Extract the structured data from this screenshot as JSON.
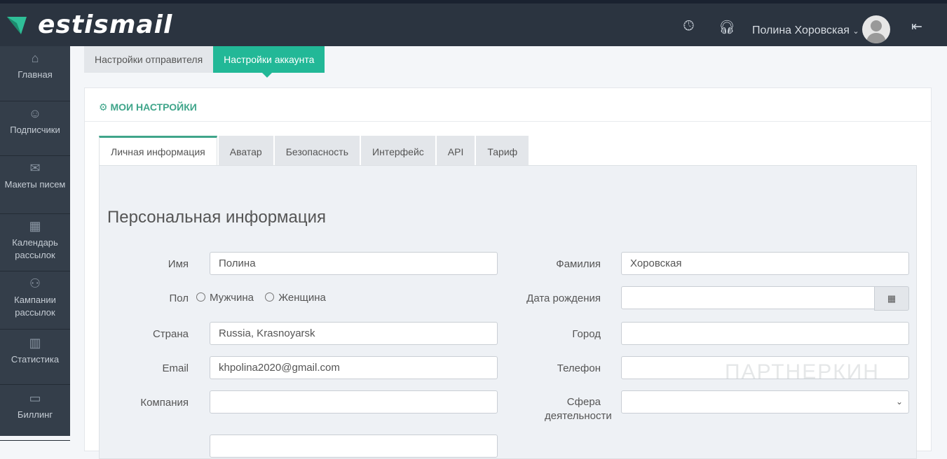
{
  "header": {
    "logo": "estismail",
    "user_name": "Полина Хоровская"
  },
  "sidebar": {
    "items": [
      {
        "label": "Главная",
        "icon": "home-icon"
      },
      {
        "label": "Подписчики",
        "icon": "users-icon"
      },
      {
        "label": "Макеты писем",
        "icon": "envelope-icon"
      },
      {
        "label": "Календарь рассылок",
        "icon": "calendar-icon"
      },
      {
        "label": "Кампании рассылок",
        "icon": "campaign-icon"
      },
      {
        "label": "Статистика",
        "icon": "chart-icon"
      },
      {
        "label": "Биллинг",
        "icon": "folder-icon"
      }
    ]
  },
  "top_tabs": [
    "Настройки отправителя",
    "Настройки аккаунта"
  ],
  "card": {
    "title": "МОИ НАСТРОЙКИ",
    "tabs": [
      "Личная информация",
      "Аватар",
      "Безопасность",
      "Интерфейс",
      "API",
      "Тариф"
    ]
  },
  "form": {
    "heading": "Персональная информация",
    "first_name_label": "Имя",
    "first_name": "Полина",
    "last_name_label": "Фамилия",
    "last_name": "Хоровская",
    "gender_label": "Пол",
    "male": "Мужчина",
    "female": "Женщина",
    "birth_label": "Дата рождения",
    "country_label": "Страна",
    "country": "Russia, Krasnoyarsk",
    "city_label": "Город",
    "email_label": "Email",
    "email": "khpolina2020@gmail.com",
    "phone_label": "Телефон",
    "company_label": "Компания",
    "sphere_label": "Сфера деятельности"
  },
  "watermark": "ПАРТНЕРКИН"
}
